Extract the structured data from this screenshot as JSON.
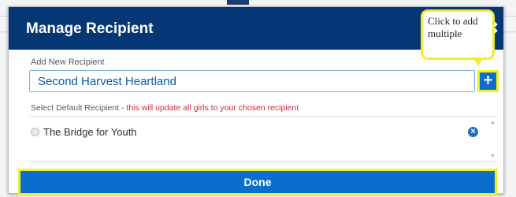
{
  "modal": {
    "title": "Manage Recipient",
    "close_icon": "close-icon"
  },
  "add_recipient": {
    "label": "Add New Recipient",
    "value": "Second Harvest Heartland",
    "add_button_glyph": "+"
  },
  "default_recipient": {
    "label": "Select Default Recipient - ",
    "warning": "this will update all girls to your chosen recipient"
  },
  "recipients": [
    {
      "name": "The Bridge for Youth"
    }
  ],
  "tooltip": {
    "text": "Click to add multiple"
  },
  "done_button": {
    "label": "Done"
  },
  "colors": {
    "header": "#063775",
    "primary": "#0a6ecf",
    "highlight": "#f3ee27",
    "warning": "#d7253d"
  }
}
